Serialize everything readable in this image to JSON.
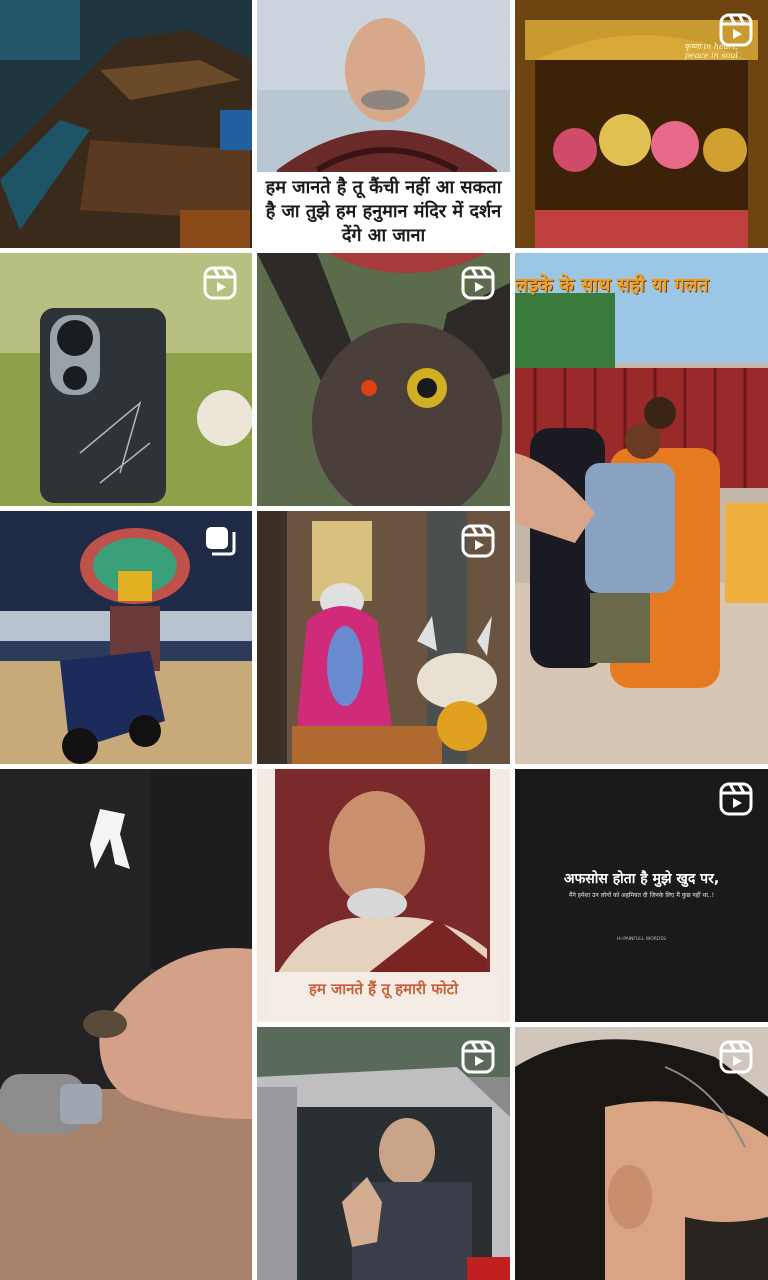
{
  "grid": {
    "tiles": [
      {
        "id": "t1",
        "kind": "photo",
        "subject": "weathered wooden boat",
        "badge": null
      },
      {
        "id": "t2",
        "kind": "reel",
        "subject": "elderly saint portrait",
        "badge": null,
        "caption_lines": [
          "हम जानते है तू कैंची नहीं आ सकता",
          "है जा तुझे हम हनुमान मंदिर में दर्शन",
          "देंगे आ जाना"
        ]
      },
      {
        "id": "t3",
        "kind": "reel",
        "subject": "golden temple shrine",
        "badge": "reel-icon",
        "overlay_text": "कृष्णा in heart, peace in soul"
      },
      {
        "id": "t4",
        "kind": "reel",
        "subject": "cracked smartphone",
        "badge": "reel-icon"
      },
      {
        "id": "t5",
        "kind": "reel",
        "subject": "bull statue",
        "badge": "reel-icon"
      },
      {
        "id": "t6",
        "kind": "reel",
        "subject": "crowd at temple gate",
        "badge": null,
        "banner_text": "लड़के के साथ सही या गलत"
      },
      {
        "id": "t7",
        "kind": "carousel",
        "subject": "performer on scooter",
        "badge": "carousel-icon"
      },
      {
        "id": "t8",
        "kind": "reel",
        "subject": "flower decorated shrine",
        "badge": "reel-icon"
      },
      {
        "id": "t9",
        "kind": "reel",
        "subject": "hand holding insect",
        "badge": null
      },
      {
        "id": "t10",
        "kind": "reel",
        "subject": "smiling elderly saint",
        "badge": null,
        "caption_lines": [
          "हम जानते हैं तू हमारी फोटो"
        ]
      },
      {
        "id": "t11",
        "kind": "reel",
        "subject": "hindi quote text",
        "badge": "reel-icon",
        "quote_main": "अफसोस होता है मुझे खुद पर,",
        "quote_sub": "मैंने हमेशा उन लोगों को अहमियत दी जिनके लिए मैं कुछ नहीं था..!",
        "quote_tag": "Hi-PAINFULL WORDSS"
      },
      {
        "id": "t12",
        "kind": "reel",
        "subject": "man waving from car",
        "badge": "reel-icon"
      },
      {
        "id": "t13",
        "kind": "reel",
        "subject": "man profile haircut",
        "badge": "reel-icon"
      }
    ]
  },
  "colors": {
    "gridBackground": "#ffffff",
    "badgeColor": "#ffffff",
    "bannerOrange": "#f0a020",
    "captionOrange": "#c6613b"
  }
}
